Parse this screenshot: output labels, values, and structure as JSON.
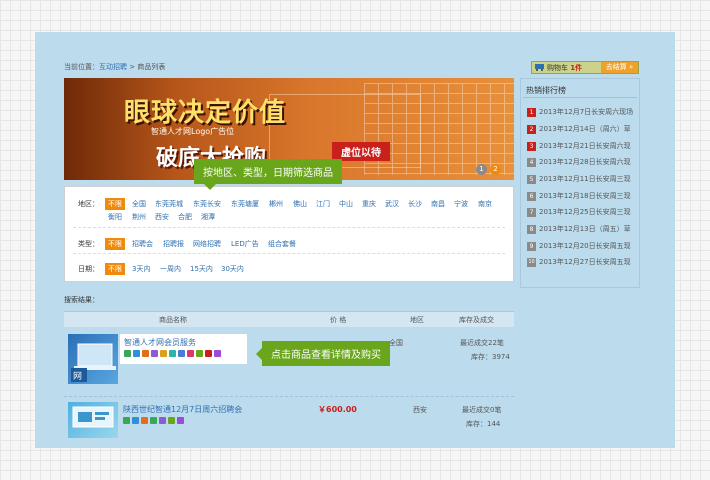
{
  "breadcrumb": {
    "prefix": "当前位置：",
    "link": "互动招聘",
    "sep": " > ",
    "current": "商品列表"
  },
  "banner": {
    "headline": "眼球决定价值",
    "logo_slot": "智通人才网Logo广告位",
    "subline": "破底大抢购",
    "vacant": "虚位以待",
    "pager": [
      "1",
      "2"
    ]
  },
  "tooltips": {
    "filter": "按地区、类型，日期筛选商品",
    "product": "点击商品查看详情及购买"
  },
  "filters": {
    "region": {
      "label": "地区：",
      "selected": "不限",
      "row1": [
        "全国",
        "东莞莞城",
        "东莞长安",
        "东莞塘厦",
        "郴州",
        "佛山",
        "江门",
        "中山",
        "重庆",
        "武汉",
        "长沙",
        "南昌",
        "宁波",
        "南京"
      ],
      "row2": [
        "衡阳",
        "荆州",
        "西安",
        "合肥",
        "湘潭"
      ]
    },
    "type": {
      "label": "类型：",
      "selected": "不限",
      "items": [
        "招聘会",
        "招聘报",
        "网络招聘",
        "LED广告",
        "组合套餐"
      ]
    },
    "date": {
      "label": "日期：",
      "selected": "不限",
      "items": [
        "3天内",
        "一周内",
        "15天内",
        "30天内"
      ]
    }
  },
  "results": {
    "label": "搜索结果：",
    "columns": [
      "商品名称",
      "价 格",
      "地区",
      "库存及成交"
    ],
    "rows": [
      {
        "name": "智通人才网会员服务",
        "price": "",
        "region": "全国",
        "sold": "最近成交22笔",
        "stock": "库存：3974"
      },
      {
        "name": "陕西世纪智通12月7日周六招聘会",
        "price": "￥600.00",
        "region": "西安",
        "sold": "最近成交0笔",
        "stock": "库存：144"
      }
    ]
  },
  "cart": {
    "text": "购物车",
    "count": "1件",
    "checkout": "去结算 »"
  },
  "ranking": {
    "title": "热销排行榜",
    "items": [
      {
        "rank": "1",
        "text": "2013年12月7日长安周六现场"
      },
      {
        "rank": "2",
        "text": "2013年12月14日（周六）草"
      },
      {
        "rank": "3",
        "text": "2013年12月21日长安周六现"
      },
      {
        "rank": "4",
        "text": "2013年12月28日长安周六现"
      },
      {
        "rank": "5",
        "text": "2013年12月11日长安周三现"
      },
      {
        "rank": "6",
        "text": "2013年12月18日长安周三现"
      },
      {
        "rank": "7",
        "text": "2013年12月25日长安周三现"
      },
      {
        "rank": "8",
        "text": "2013年12月13日（周五）草"
      },
      {
        "rank": "9",
        "text": "2013年12月20日长安周五现"
      },
      {
        "rank": "10",
        "text": "2013年12月27日长安周五现"
      }
    ]
  },
  "colors": {
    "accent": "#f08a0c",
    "tooltip": "#6aa61c",
    "link": "#2f6fb0",
    "panel": "#bcdcee",
    "rank_red": "#c9201c",
    "rank_grey": "#8a8a8a"
  }
}
